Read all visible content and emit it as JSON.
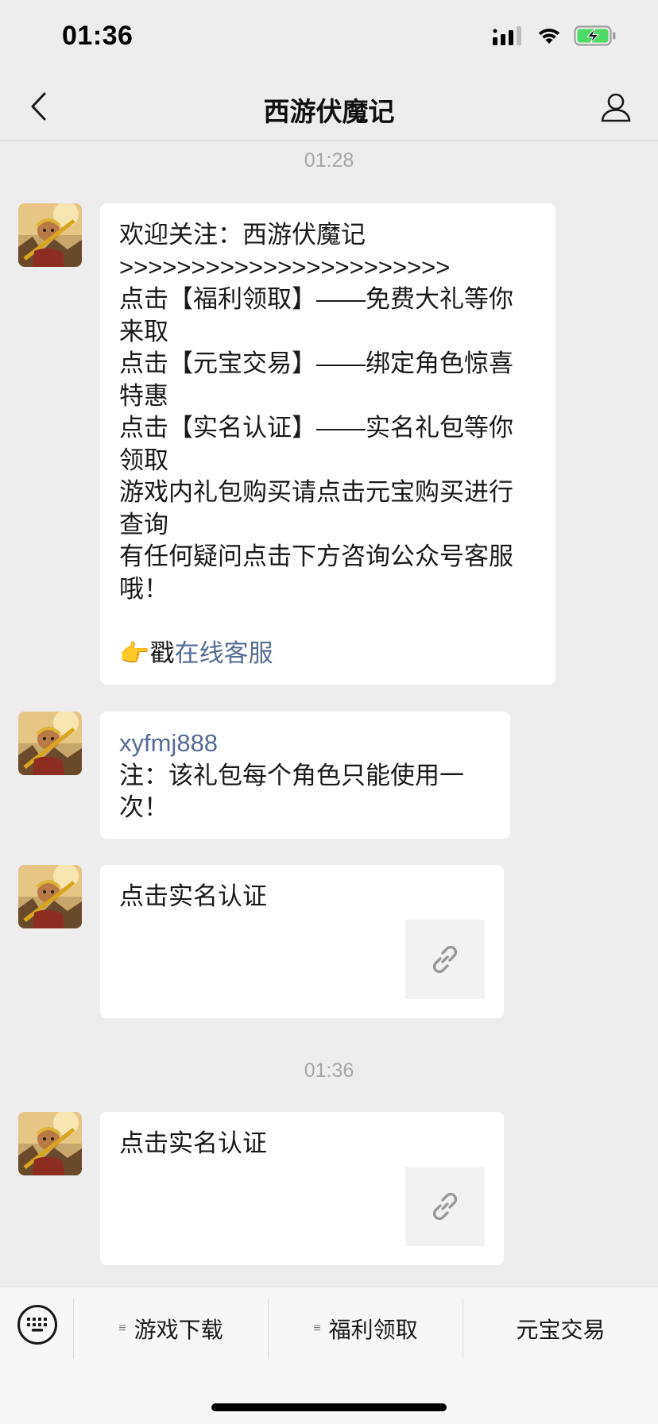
{
  "status_bar": {
    "time": "01:36",
    "signal_icon": "signal-bars-icon",
    "wifi_icon": "wifi-icon",
    "battery_icon": "battery-charging-icon"
  },
  "nav": {
    "title": "西游伏魔记",
    "back_icon": "chevron-left-icon",
    "profile_icon": "person-icon"
  },
  "messages": {
    "time_1": "01:28",
    "welcome": {
      "lines": [
        "欢迎关注：西游伏魔记",
        ">>>>>>>>>>>>>>>>>>>>>>>",
        "点击【福利领取】——免费大礼等你来取",
        "点击【元宝交易】——绑定角色惊喜特惠",
        "点击【实名认证】——实名礼包等你领取",
        "游戏内礼包购买请点击元宝购买进行查询",
        "有任何疑问点击下方咨询公众号客服哦！"
      ],
      "cta_emoji": "👉",
      "cta_prefix": "戳",
      "cta_link": "在线客服"
    },
    "code": {
      "code_text": "xyfmj888",
      "note": "注：该礼包每个角色只能使用一次！"
    },
    "link_card_1": {
      "title": "点击实名认证",
      "icon": "link-icon"
    },
    "time_2": "01:36",
    "link_card_2": {
      "title": "点击实名认证",
      "icon": "link-icon"
    }
  },
  "bottom_menu": {
    "keyboard_icon": "keyboard-icon",
    "items": [
      {
        "label": "游戏下载",
        "has_submenu": true
      },
      {
        "label": "福利领取",
        "has_submenu": true
      },
      {
        "label": "元宝交易",
        "has_submenu": false
      }
    ]
  },
  "colors": {
    "background": "#ededed",
    "bubble": "#ffffff",
    "link": "#576b95",
    "timestamp": "#a7a7a7"
  }
}
